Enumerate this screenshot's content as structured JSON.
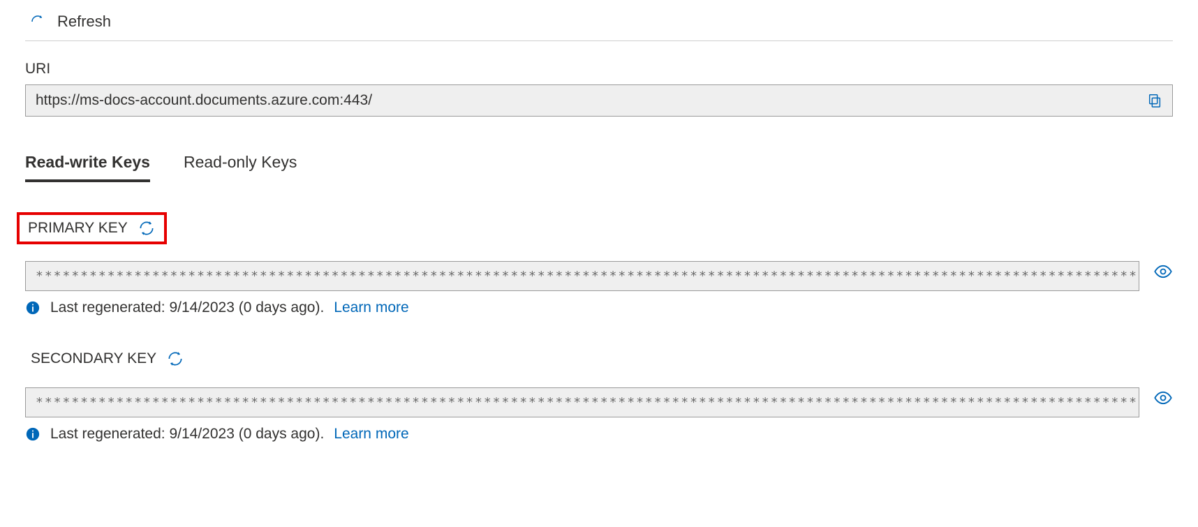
{
  "topbar": {
    "refresh_label": "Refresh"
  },
  "uri": {
    "label": "URI",
    "value": "https://ms-docs-account.documents.azure.com:443/"
  },
  "tabs": {
    "read_write": "Read-write Keys",
    "read_only": "Read-only Keys"
  },
  "keys": {
    "primary": {
      "label": "PRIMARY KEY",
      "masked": "****************************************************************************************************************************************************************",
      "status_prefix": "Last regenerated: ",
      "status_date": "9/14/2023 (0 days ago).",
      "learn_more": "Learn more"
    },
    "secondary": {
      "label": "SECONDARY KEY",
      "masked": "****************************************************************************************************************************************************************",
      "status_prefix": "Last regenerated: ",
      "status_date": "9/14/2023 (0 days ago).",
      "learn_more": "Learn more"
    }
  },
  "colors": {
    "link": "#0067b8",
    "highlight": "#e60000",
    "icon_blue": "#0067b8"
  }
}
